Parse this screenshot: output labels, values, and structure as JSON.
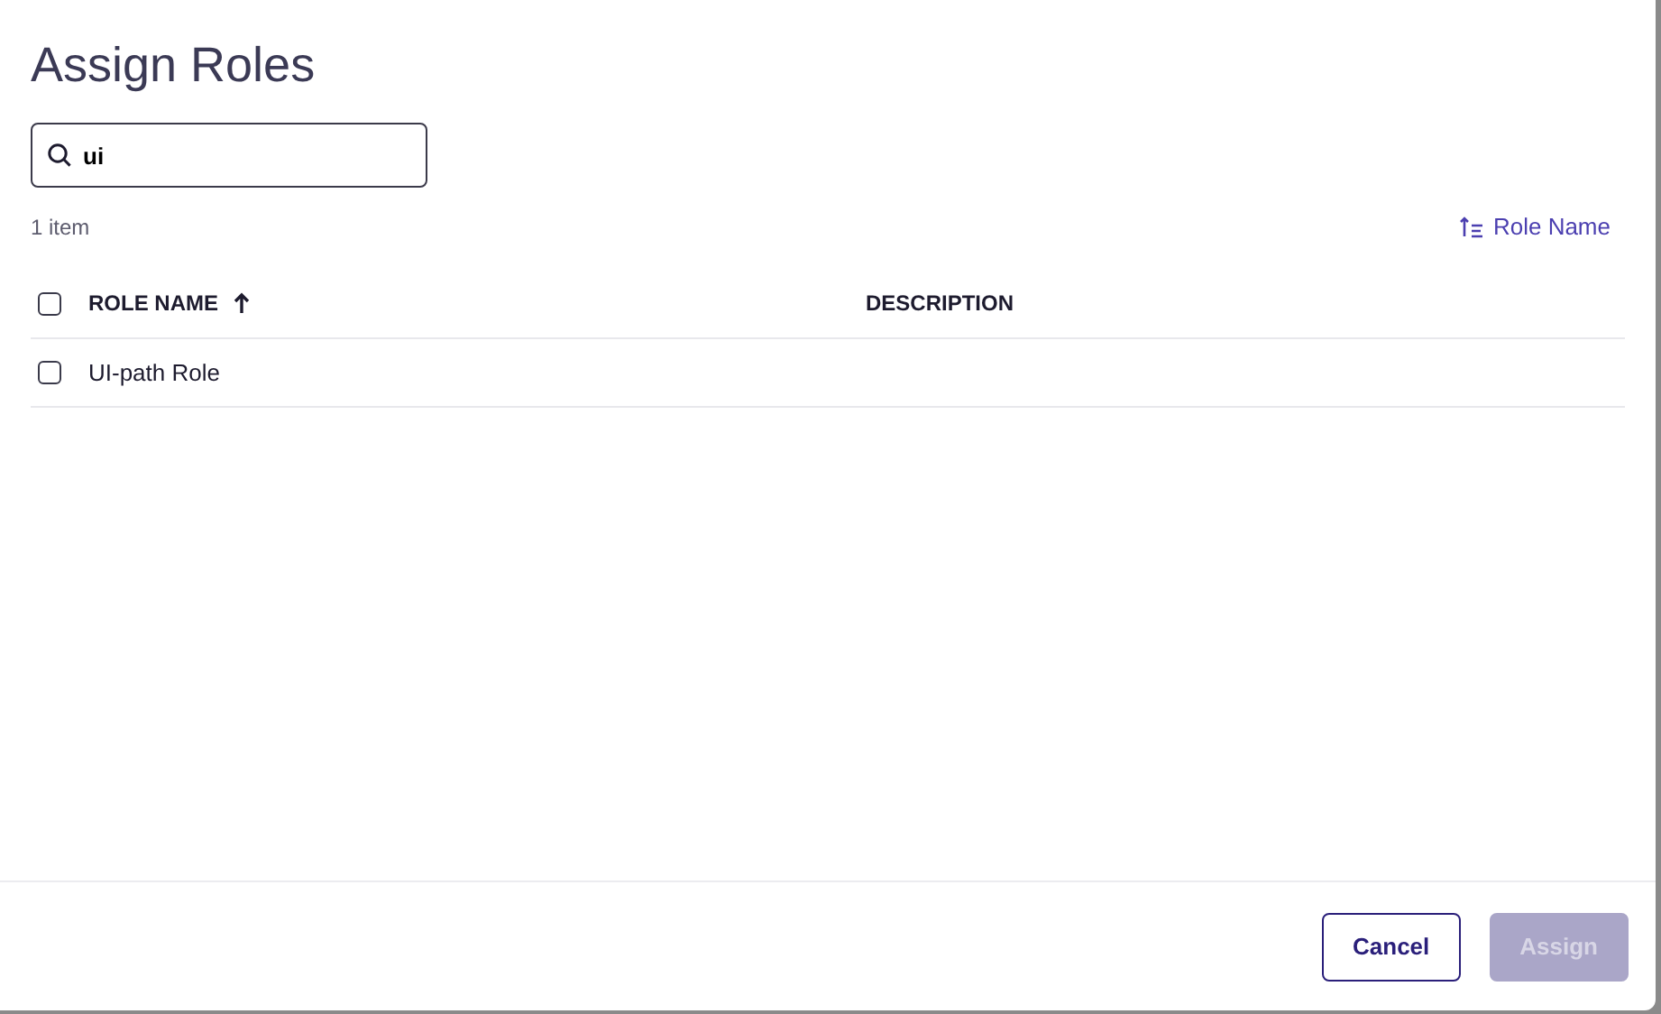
{
  "dialog": {
    "title": "Assign Roles"
  },
  "search": {
    "value": "ui"
  },
  "item_count": "1 item",
  "sort_button": {
    "label": "Role Name"
  },
  "table": {
    "select_all": {
      "checked": false
    },
    "columns": [
      {
        "label": "ROLE NAME",
        "sorted": true
      },
      {
        "label": "DESCRIPTION",
        "sorted": false
      }
    ],
    "rows": [
      {
        "checked": false,
        "cells": [
          "UI-path Role",
          ""
        ]
      }
    ]
  },
  "buttons": [
    {
      "label": "Cancel",
      "kind": "secondary",
      "disabled": false
    },
    {
      "label": "Assign",
      "kind": "primary",
      "disabled": true
    }
  ]
}
